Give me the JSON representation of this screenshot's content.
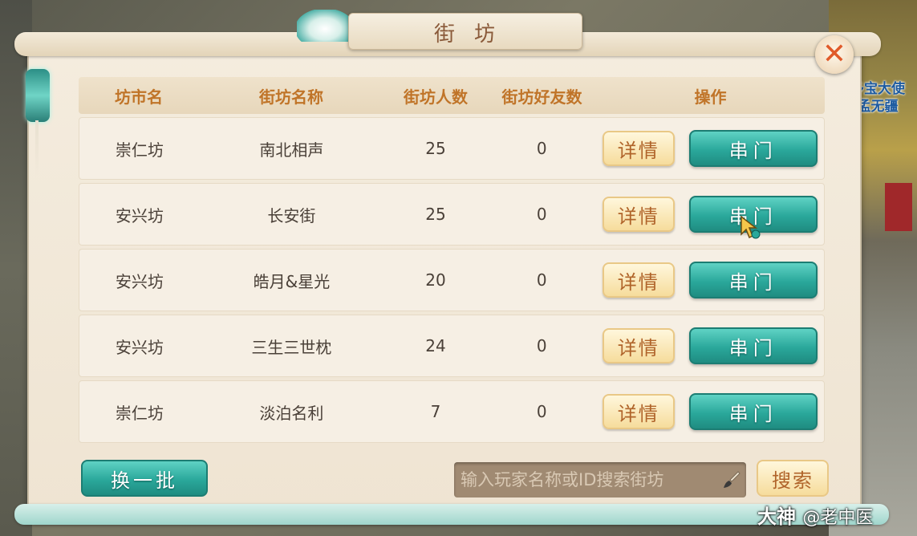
{
  "window": {
    "title": "街坊"
  },
  "npc_label": "多宝大使\n孟无疆",
  "table": {
    "headers": [
      "坊市名",
      "街坊名称",
      "街坊人数",
      "街坊好友数",
      "操作"
    ],
    "rows": [
      {
        "market": "崇仁坊",
        "name": "南北相声",
        "members": "25",
        "friends": "0"
      },
      {
        "market": "安兴坊",
        "name": "长安街",
        "members": "25",
        "friends": "0"
      },
      {
        "market": "安兴坊",
        "name": "皓月&星光",
        "members": "20",
        "friends": "0"
      },
      {
        "market": "安兴坊",
        "name": "三生三世枕",
        "members": "24",
        "friends": "0"
      },
      {
        "market": "崇仁坊",
        "name": "淡泊名利",
        "members": "7",
        "friends": "0"
      }
    ],
    "detail_label": "详情",
    "visit_label": "串门"
  },
  "footer": {
    "refresh_label": "换一批",
    "search_placeholder": "输入玩家名称或ID搜索街坊",
    "search_label": "搜索"
  },
  "watermark": {
    "brand": "大神",
    "handle": "@老中医"
  },
  "colors": {
    "accent_teal": "#2aa89b",
    "header_text": "#c07428",
    "detail_text": "#b0642a",
    "close_x": "#e05a2a"
  }
}
